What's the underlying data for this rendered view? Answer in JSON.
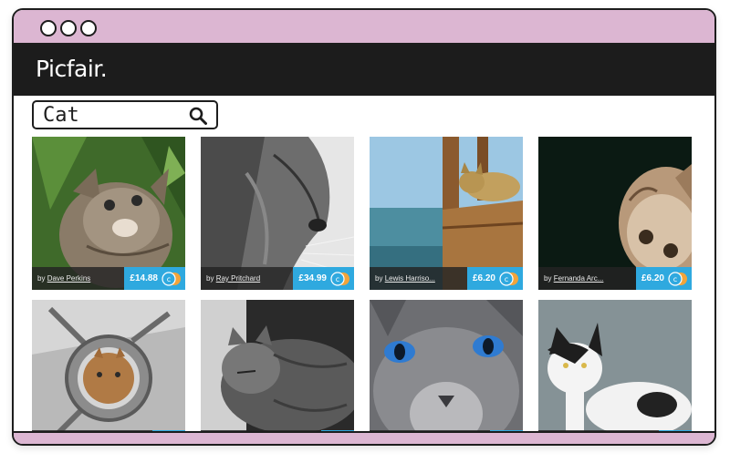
{
  "brand": {
    "name": "Picfair."
  },
  "search": {
    "value": "Cat",
    "icon": "search-icon"
  },
  "window_controls": [
    "window-dot-1",
    "window-dot-2",
    "window-dot-3"
  ],
  "photos": [
    {
      "by_prefix": "by",
      "photographer": "Dave Perkins",
      "price": "£14.88"
    },
    {
      "by_prefix": "by",
      "photographer": "Ray Pritchard",
      "price": "£34.99"
    },
    {
      "by_prefix": "by",
      "photographer": "Lewis Harriso...",
      "price": "£6.20"
    },
    {
      "by_prefix": "by",
      "photographer": "Fernanda Arc...",
      "price": "£6.20"
    },
    {
      "by_prefix": "",
      "photographer": "",
      "price": ""
    },
    {
      "by_prefix": "",
      "photographer": "",
      "price": ""
    },
    {
      "by_prefix": "",
      "photographer": "",
      "price": ""
    },
    {
      "by_prefix": "",
      "photographer": "",
      "price": ""
    }
  ],
  "colors": {
    "titlebar": "#dcb6d2",
    "header": "#1c1c1c",
    "price_badge": "#2fa9df",
    "coin_blue": "#2fa9df",
    "coin_orange": "#f2a43a"
  }
}
